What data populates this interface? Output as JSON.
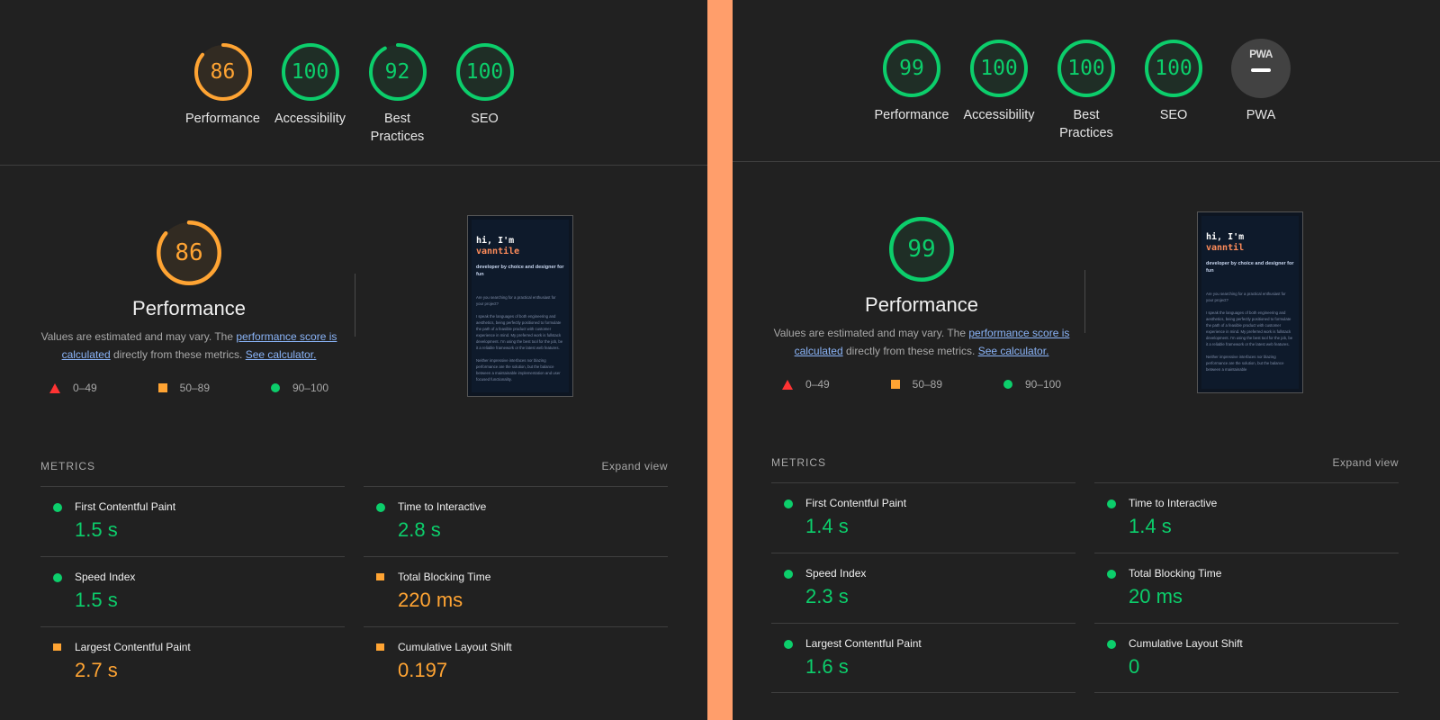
{
  "colors": {
    "pass": "#0cce6b",
    "average": "#ffa433",
    "fail": "#ff3333",
    "divider": "#ff9e6b"
  },
  "legend": {
    "fail": "0–49",
    "average": "50–89",
    "pass": "90–100"
  },
  "left": {
    "gauges": [
      {
        "score": 86,
        "label": "Performance",
        "status": "average"
      },
      {
        "score": 100,
        "label": "Accessibility",
        "status": "pass"
      },
      {
        "score": 92,
        "label": "Best Practices",
        "status": "pass"
      },
      {
        "score": 100,
        "label": "SEO",
        "status": "pass"
      }
    ],
    "perf": {
      "score": 86,
      "status": "average",
      "title": "Performance",
      "desc_pre": "Values are estimated and may vary. The ",
      "link1": "performance score is calculated",
      "desc_mid": " directly from these metrics. ",
      "link2": "See calculator."
    },
    "thumb": {
      "line1": "hi, I'm",
      "line2": "vanntile",
      "tagline": "developer by choice and designer for fun",
      "p1": "Are you searching for a practical enthusiast for your project?",
      "p2": "I speak the languages of both engineering and aesthetics, being perfectly positioned to formulate the path of a feasible product with customer experience in mind. My preferred work is fullstack development. I'm using the best tool for the job, be it a reliable framework or the latest web features.",
      "p3": "Neither impressive interfaces nor blazing performance are the solution, but the balance between a maintainable implementation and user focused functionality."
    },
    "metrics_title": "METRICS",
    "expand": "Expand view",
    "metrics": [
      {
        "name": "First Contentful Paint",
        "value": "1.5 s",
        "status": "pass"
      },
      {
        "name": "Time to Interactive",
        "value": "2.8 s",
        "status": "pass"
      },
      {
        "name": "Speed Index",
        "value": "1.5 s",
        "status": "pass"
      },
      {
        "name": "Total Blocking Time",
        "value": "220 ms",
        "status": "average"
      },
      {
        "name": "Largest Contentful Paint",
        "value": "2.7 s",
        "status": "average"
      },
      {
        "name": "Cumulative Layout Shift",
        "value": "0.197",
        "status": "average"
      }
    ]
  },
  "right": {
    "gauges": [
      {
        "score": 99,
        "label": "Performance",
        "status": "pass"
      },
      {
        "score": 100,
        "label": "Accessibility",
        "status": "pass"
      },
      {
        "score": 100,
        "label": "Best Practices",
        "status": "pass"
      },
      {
        "score": 100,
        "label": "SEO",
        "status": "pass"
      }
    ],
    "pwa": {
      "badge": "PWA",
      "label": "PWA"
    },
    "perf": {
      "score": 99,
      "status": "pass",
      "title": "Performance",
      "desc_pre": "Values are estimated and may vary. The ",
      "link1": "performance score is calculated",
      "desc_mid": " directly from these metrics. ",
      "link2": "See calculator."
    },
    "thumb": {
      "line1": "hi, I'm",
      "line2": "vanntil",
      "tagline": "developer by choice and designer for fun",
      "p1": "Are you searching for a practical enthusiast for your project?",
      "p2": "I speak the languages of both engineering and aesthetics, being perfectly positioned to formulate the path of a feasible product with customer experience in mind. My preferred work is fullstack development. I'm using the best tool for the job, be it a reliable framework or the latest web features.",
      "p3": "Neither impressive interfaces nor blazing performance are the solution, but the balance between a maintainable"
    },
    "metrics_title": "METRICS",
    "expand": "Expand view",
    "metrics": [
      {
        "name": "First Contentful Paint",
        "value": "1.4 s",
        "status": "pass"
      },
      {
        "name": "Time to Interactive",
        "value": "1.4 s",
        "status": "pass"
      },
      {
        "name": "Speed Index",
        "value": "2.3 s",
        "status": "pass"
      },
      {
        "name": "Total Blocking Time",
        "value": "20 ms",
        "status": "pass"
      },
      {
        "name": "Largest Contentful Paint",
        "value": "1.6 s",
        "status": "pass"
      },
      {
        "name": "Cumulative Layout Shift",
        "value": "0",
        "status": "pass"
      }
    ]
  }
}
